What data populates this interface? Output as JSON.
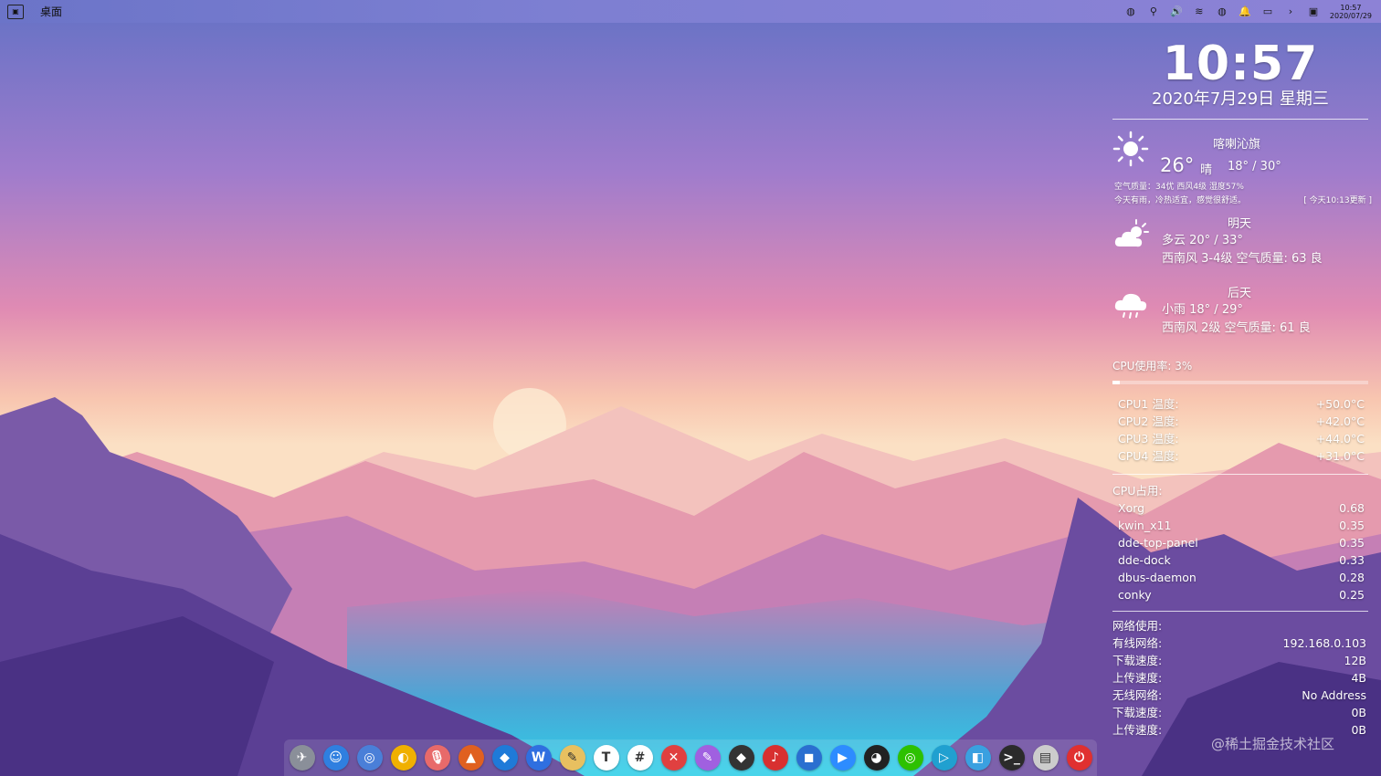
{
  "topbar": {
    "title": "桌面",
    "clock_time": "10:57",
    "clock_date": "2020/07/29"
  },
  "conky": {
    "time": "10:57",
    "date": "2020年7月29日 星期三",
    "weather": {
      "city": "喀喇沁旗",
      "temp": "26°",
      "condition": "晴",
      "range": "18° / 30°",
      "air": "空气质量：34优  西风4级  湿度57%",
      "note": "今天有雨，冷热适宜，感觉很舒适。",
      "updated": "[ 今天10:13更新 ]"
    },
    "forecast": [
      {
        "day": "明天",
        "line1": "多云 20° / 33°",
        "line2": "西南风 3-4级  空气质量: 63 良"
      },
      {
        "day": "后天",
        "line1": "小雨 18° / 29°",
        "line2": "西南风 2级  空气质量: 61 良"
      }
    ],
    "cpu_usage_label": "CPU使用率: 3%",
    "cpu_usage_fraction": 0.03,
    "cpu_temps": [
      {
        "label": "CPU1 温度:",
        "value": "+50.0°C"
      },
      {
        "label": "CPU2 温度:",
        "value": "+42.0°C"
      },
      {
        "label": "CPU3 温度:",
        "value": "+44.0°C"
      },
      {
        "label": "CPU4 温度:",
        "value": "+31.0°C"
      }
    ],
    "cpu_top_label": "CPU占用:",
    "processes": [
      {
        "name": "Xorg",
        "value": "0.68"
      },
      {
        "name": "kwin_x11",
        "value": "0.35"
      },
      {
        "name": "dde-top-panel",
        "value": "0.35"
      },
      {
        "name": "dde-dock",
        "value": "0.33"
      },
      {
        "name": "dbus-daemon",
        "value": "0.28"
      },
      {
        "name": "conky",
        "value": "0.25"
      }
    ],
    "net_label": "网络使用:",
    "net": [
      {
        "label": "有线网络:",
        "value": "192.168.0.103"
      },
      {
        "label": "下载速度:",
        "value": "12B"
      },
      {
        "label": "上传速度:",
        "value": "4B"
      },
      {
        "label": "无线网络:",
        "value": "No Address"
      },
      {
        "label": "下载速度:",
        "value": "0B"
      },
      {
        "label": "上传速度:",
        "value": "0B"
      }
    ]
  },
  "dock_apps": [
    {
      "name": "launcher",
      "glyph": "✈",
      "color": "#8a8f99"
    },
    {
      "name": "finder",
      "glyph": "☺",
      "color": "#2f7fe0"
    },
    {
      "name": "chrome",
      "glyph": "◎",
      "color": "#4a7fd8"
    },
    {
      "name": "browser",
      "glyph": "◐",
      "color": "#f0b000"
    },
    {
      "name": "recorder",
      "glyph": "🎙",
      "color": "#e86a6a"
    },
    {
      "name": "matlab",
      "glyph": "▲",
      "color": "#e06020"
    },
    {
      "name": "vscode",
      "glyph": "◆",
      "color": "#1f7ad8"
    },
    {
      "name": "wps",
      "glyph": "W",
      "color": "#2f6fe0"
    },
    {
      "name": "editor",
      "glyph": "✎",
      "color": "#e8c060"
    },
    {
      "name": "typora",
      "glyph": "T",
      "color": "#ffffff"
    },
    {
      "name": "slack",
      "glyph": "#",
      "color": "#ffffff"
    },
    {
      "name": "xmind",
      "glyph": "✕",
      "color": "#e04040"
    },
    {
      "name": "draw",
      "glyph": "✎",
      "color": "#a060e0"
    },
    {
      "name": "inkscape",
      "glyph": "◆",
      "color": "#333333"
    },
    {
      "name": "netease-music",
      "glyph": "♪",
      "color": "#d83030"
    },
    {
      "name": "baidu-netdisk",
      "glyph": "◼",
      "color": "#2a6fd0"
    },
    {
      "name": "zoom",
      "glyph": "▶",
      "color": "#2d8cff"
    },
    {
      "name": "qq",
      "glyph": "◕",
      "color": "#222222"
    },
    {
      "name": "wechat",
      "glyph": "◎",
      "color": "#2dc100"
    },
    {
      "name": "player",
      "glyph": "▷",
      "color": "#20a0d0"
    },
    {
      "name": "map",
      "glyph": "◧",
      "color": "#3aa0e0"
    },
    {
      "name": "terminal",
      "glyph": ">_",
      "color": "#2b2b2b"
    },
    {
      "name": "trash",
      "glyph": "▤",
      "color": "#cccccc"
    },
    {
      "name": "power",
      "glyph": "⏻",
      "color": "#e03030"
    }
  ],
  "watermark": "@稀土掘金技术社区"
}
